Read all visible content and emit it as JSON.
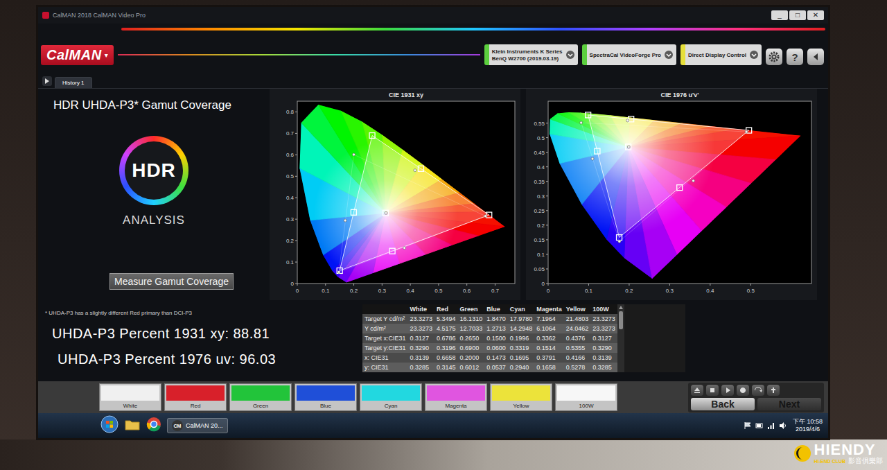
{
  "window": {
    "title": "CalMAN 2018 CalMAN Video Pro",
    "controls": [
      "_",
      "□",
      "✕"
    ]
  },
  "app": {
    "logo": "CalMAN",
    "logo_menu": "▾"
  },
  "devices": [
    {
      "lines": [
        "Klein Instruments K Series",
        "BenQ W2700 (2019.03.19)"
      ],
      "color": "#5ccf3e"
    },
    {
      "lines": [
        "SpectraCal VideoForge Pro"
      ],
      "color": "#5ccf3e"
    },
    {
      "lines": [
        "Direct Display Control"
      ],
      "color": "#e6df3a"
    }
  ],
  "toolbar": {
    "help": "?"
  },
  "tabs": [
    {
      "label": "History 1",
      "selected": true
    }
  ],
  "page": {
    "title": "HDR UHDA-P3* Gamut Coverage",
    "badge": {
      "top": "HDR",
      "bottom": "ANALYSIS"
    },
    "button": "Measure Gamut Coverage",
    "footnote": "* UHDA-P3 has a slightly different Red primary than DCI-P3",
    "results": [
      "UHDA-P3 Percent 1931 xy: 88.81",
      "UHDA-P3 Percent 1976 uv: 96.03"
    ]
  },
  "charts": [
    {
      "title": "CIE 1931 xy",
      "x_ticks": [
        "0",
        "0.1",
        "0.2",
        "0.3",
        "0.4",
        "0.5",
        "0.6",
        "0.7"
      ],
      "y_ticks": [
        "0",
        "0.1",
        "0.2",
        "0.3",
        "0.4",
        "0.5",
        "0.6",
        "0.7",
        "0.8"
      ],
      "target": {
        "x": [
          0.3127,
          0.6786,
          0.265,
          0.15,
          0.1996,
          0.3362,
          0.4376
        ],
        "y": [
          0.329,
          0.3196,
          0.69,
          0.06,
          0.3319,
          0.1514,
          0.5355
        ]
      },
      "measured": {
        "x": [
          0.3139,
          0.6658,
          0.2,
          0.1473,
          0.1695,
          0.3791,
          0.4166
        ],
        "y": [
          0.3285,
          0.3145,
          0.6012,
          0.0537,
          0.294,
          0.1658,
          0.5278
        ]
      }
    },
    {
      "title": "CIE 1976 u'v'",
      "x_ticks": [
        "0",
        "0.1",
        "0.2",
        "0.3",
        "0.4",
        "0.5"
      ],
      "y_ticks": [
        "0",
        "0.05",
        "0.1",
        "0.15",
        "0.2",
        "0.25",
        "0.3",
        "0.35",
        "0.4",
        "0.45",
        "0.5",
        "0.55"
      ],
      "target": {
        "x": [
          0.1978,
          0.4955,
          0.0986,
          0.1754,
          0.1213,
          0.3245,
          0.2047
        ],
        "y": [
          0.4683,
          0.5251,
          0.5777,
          0.1579,
          0.4537,
          0.3288,
          0.5636
        ]
      },
      "measured": {
        "x": [
          0.1989,
          0.4893,
          0.0815,
          0.1759,
          0.1095,
          0.3584,
          0.196
        ],
        "y": [
          0.4682,
          0.5201,
          0.5513,
          0.1443,
          0.4275,
          0.3526,
          0.5588
        ]
      }
    }
  ],
  "table": {
    "columns": [
      "",
      "White",
      "Red",
      "Green",
      "Blue",
      "Cyan",
      "Magenta",
      "Yellow",
      "100W"
    ],
    "rows": [
      [
        "Target Y cd/m²",
        "23.3273",
        "5.3494",
        "16.1310",
        "1.8470",
        "17.9780",
        "7.1964",
        "21.4803",
        "23.3273"
      ],
      [
        "Y cd/m²",
        "23.3273",
        "4.5175",
        "12.7033",
        "1.2713",
        "14.2948",
        "6.1064",
        "24.0462",
        "23.3273"
      ],
      [
        "Target x:CIE31",
        "0.3127",
        "0.6786",
        "0.2650",
        "0.1500",
        "0.1996",
        "0.3362",
        "0.4376",
        "0.3127"
      ],
      [
        "Target y:CIE31",
        "0.3290",
        "0.3196",
        "0.6900",
        "0.0600",
        "0.3319",
        "0.1514",
        "0.5355",
        "0.3290"
      ],
      [
        "x: CIE31",
        "0.3139",
        "0.6658",
        "0.2000",
        "0.1473",
        "0.1695",
        "0.3791",
        "0.4166",
        "0.3139"
      ],
      [
        "y: CIE31",
        "0.3285",
        "0.3145",
        "0.6012",
        "0.0537",
        "0.2940",
        "0.1658",
        "0.5278",
        "0.3285"
      ]
    ]
  },
  "swatches": [
    {
      "label": "White",
      "color": "#f0f0f0"
    },
    {
      "label": "Red",
      "color": "#d8202a"
    },
    {
      "label": "Green",
      "color": "#22c43a"
    },
    {
      "label": "Blue",
      "color": "#1f4fd8"
    },
    {
      "label": "Cyan",
      "color": "#22d8e0"
    },
    {
      "label": "Magenta",
      "color": "#e055e0"
    },
    {
      "label": "Yellow",
      "color": "#ece33a"
    },
    {
      "label": "100W",
      "color": "#f7f7f7"
    }
  ],
  "nav": {
    "back": "Back",
    "next": "Next",
    "next_disabled": true
  },
  "taskbar": {
    "task_icon": "CM",
    "task": "CalMAN 20...",
    "time": "下午 10:58",
    "date": "2019/4/6"
  },
  "watermark": {
    "brand": "HIENDY",
    "sub": "HI-END CLUB",
    "cn": "影音俱樂部"
  }
}
